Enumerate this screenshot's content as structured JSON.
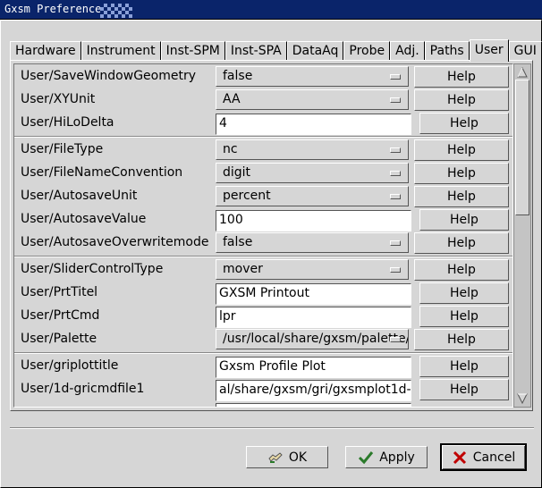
{
  "window": {
    "title": "Gxsm Preferences"
  },
  "tabs": [
    {
      "label": "Hardware"
    },
    {
      "label": "Instrument"
    },
    {
      "label": "Inst-SPM"
    },
    {
      "label": "Inst-SPA"
    },
    {
      "label": "DataAq"
    },
    {
      "label": "Probe"
    },
    {
      "label": "Adj."
    },
    {
      "label": "Paths"
    },
    {
      "label": "User"
    },
    {
      "label": "GUI"
    }
  ],
  "active_tab": "User",
  "settings": [
    {
      "label": "User/SaveWindowGeometry",
      "kind": "dropdown",
      "value": "false"
    },
    {
      "label": "User/XYUnit",
      "kind": "dropdown",
      "value": "AA"
    },
    {
      "label": "User/HiLoDelta",
      "kind": "text",
      "value": "4"
    },
    {
      "label": "User/FileType",
      "kind": "dropdown",
      "value": "nc"
    },
    {
      "label": "User/FileNameConvention",
      "kind": "dropdown",
      "value": "digit"
    },
    {
      "label": "User/AutosaveUnit",
      "kind": "dropdown",
      "value": "percent"
    },
    {
      "label": "User/AutosaveValue",
      "kind": "text",
      "value": "100"
    },
    {
      "label": "User/AutosaveOverwritemode",
      "kind": "dropdown",
      "value": "false"
    },
    {
      "label": "User/SliderControlType",
      "kind": "dropdown",
      "value": "mover"
    },
    {
      "label": "User/PrtTitel",
      "kind": "text",
      "value": "GXSM Printout"
    },
    {
      "label": "User/PrtCmd",
      "kind": "text",
      "value": "lpr"
    },
    {
      "label": "User/Palette",
      "kind": "dropdown",
      "value": "/usr/local/share/gxsm/palette/"
    },
    {
      "label": "User/griplottitle",
      "kind": "text",
      "value": "Gxsm Profile Plot"
    },
    {
      "label": "User/1d-gricmdfile1",
      "kind": "text",
      "value": "al/share/gxsm/gri/gxsmplot1d-1.gri"
    }
  ],
  "help_label": "Help",
  "buttons": {
    "ok": "OK",
    "apply": "Apply",
    "cancel": "Cancel"
  },
  "icons": {
    "ok": "ok-hand-icon",
    "apply": "checkmark-icon",
    "cancel": "red-x-icon"
  },
  "colors": {
    "titlebar": "#0a246a",
    "background": "#d6d6d6",
    "cancel_icon": "#c00000",
    "apply_icon": "#2a7a2a"
  }
}
